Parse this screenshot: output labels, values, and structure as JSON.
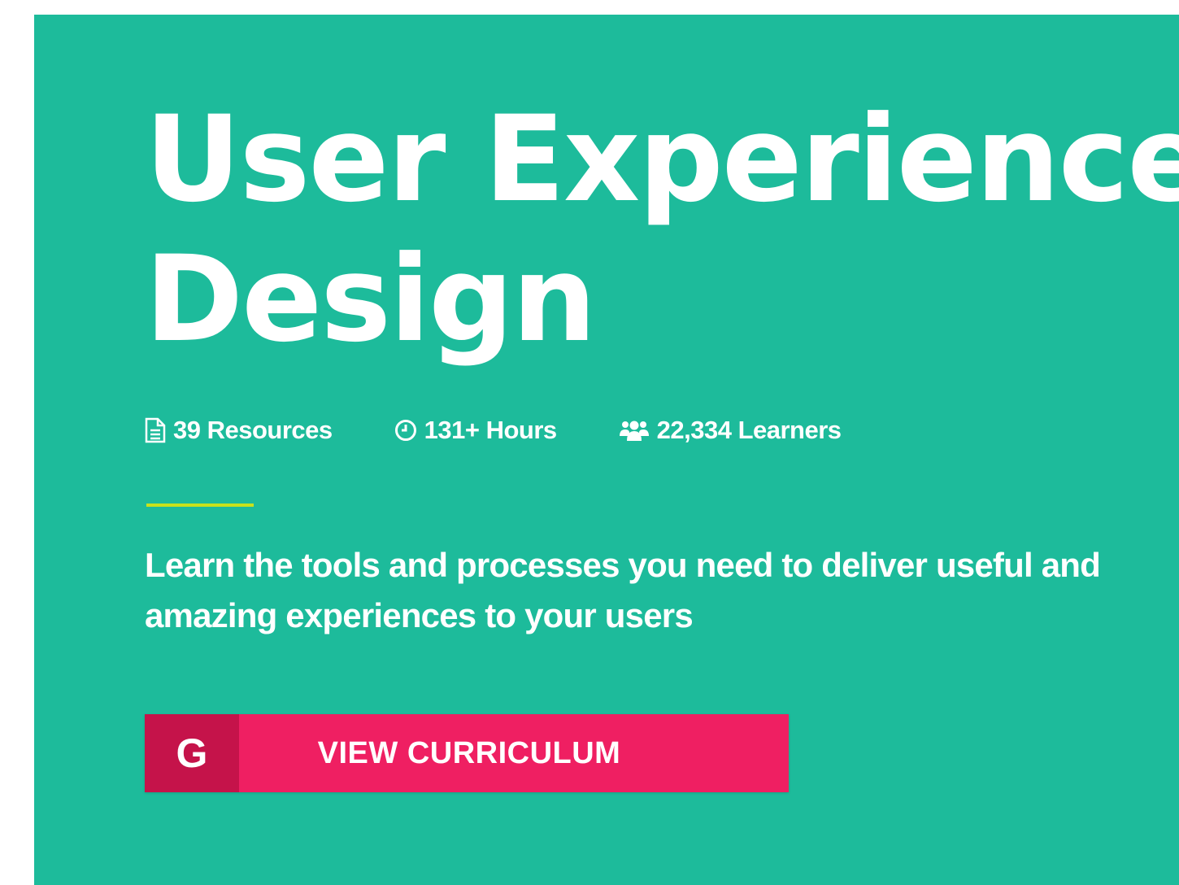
{
  "hero": {
    "background_color": "#1dbb9b",
    "title_line1": "User Experience",
    "title_line2": "Design",
    "stats": [
      {
        "icon": "document-icon",
        "text": "39 Resources"
      },
      {
        "icon": "clock-icon",
        "text": "131+ Hours"
      },
      {
        "icon": "users-icon",
        "text": "22,334 Learners"
      }
    ],
    "divider_color": "#c8e21c",
    "description": "Learn the tools and processes you need to deliver useful and amazing experiences to your users",
    "cta": {
      "icon": "google-g-icon",
      "icon_text": "G",
      "label": "VIEW CURRICULUM",
      "color": "#ef1f62",
      "icon_bg_color": "#c5134a"
    }
  }
}
